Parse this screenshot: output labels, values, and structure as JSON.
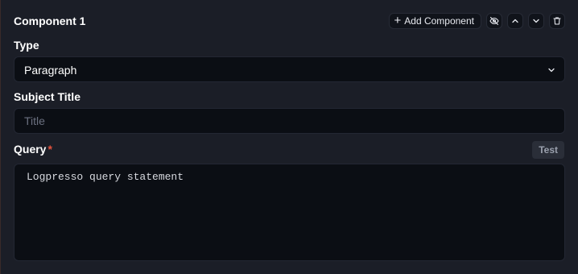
{
  "component": {
    "title": "Component 1",
    "add_button_label": "Add Component",
    "icons": {
      "add": "plus-icon",
      "visibility": "eye-off-icon",
      "move_up": "chevron-up-icon",
      "move_down": "chevron-down-icon",
      "delete": "trash-icon"
    }
  },
  "type_field": {
    "label": "Type",
    "selected": "Paragraph"
  },
  "subject_title_field": {
    "label": "Subject Title",
    "placeholder": "Title",
    "value": ""
  },
  "query_field": {
    "label": "Query",
    "required_marker": "*",
    "test_button_label": "Test",
    "placeholder": "Logpresso query statement",
    "value": ""
  },
  "colors": {
    "background": "#1b1e27",
    "field_background": "#0b0e14",
    "required": "#e5533d",
    "placeholder": "#6b7080"
  }
}
